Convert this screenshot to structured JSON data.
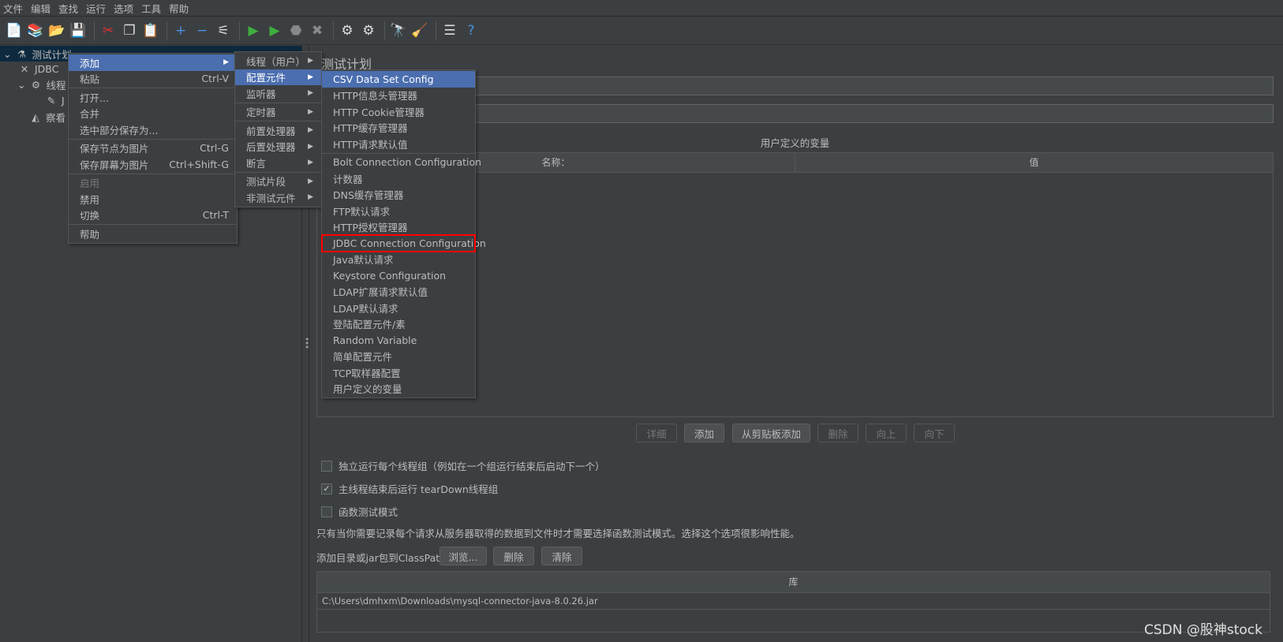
{
  "menubar": [
    "文件",
    "编辑",
    "查找",
    "运行",
    "选项",
    "工具",
    "帮助"
  ],
  "toolbar": [
    {
      "icon": "new-icon",
      "g": "📄"
    },
    {
      "icon": "templates-icon",
      "g": "📚"
    },
    {
      "icon": "open-icon",
      "g": "📂"
    },
    {
      "icon": "save-icon",
      "g": "💾"
    },
    "sep",
    {
      "icon": "cut-icon",
      "g": "✂"
    },
    {
      "icon": "copy-icon",
      "g": "❐"
    },
    {
      "icon": "paste-icon",
      "g": "📋"
    },
    "sep",
    {
      "icon": "expand-icon",
      "g": "+"
    },
    {
      "icon": "collapse-icon",
      "g": "−"
    },
    {
      "icon": "toggle-icon",
      "g": "⚟"
    },
    "sep",
    {
      "icon": "start-icon",
      "g": "▶"
    },
    {
      "icon": "start-no-pause-icon",
      "g": "▶"
    },
    {
      "icon": "stop-icon",
      "g": "⬣"
    },
    {
      "icon": "shutdown-icon",
      "g": "✖"
    },
    "sep",
    {
      "icon": "clear-icon",
      "g": "⚙"
    },
    {
      "icon": "clear-all-icon",
      "g": "⚙"
    },
    "sep",
    {
      "icon": "search-icon",
      "g": "🔭"
    },
    {
      "icon": "reset-search-icon",
      "g": "🧹"
    },
    "sep",
    {
      "icon": "function-helper-icon",
      "g": "☰"
    },
    {
      "icon": "help-icon",
      "g": "?"
    }
  ],
  "tree": [
    {
      "label": "测试计划",
      "icon": "test-plan-icon",
      "g": "⚗",
      "arrow": "⌄"
    },
    {
      "label": "JDBC",
      "icon": "jdbc-config-icon",
      "g": "✕"
    },
    {
      "label": "线程",
      "icon": "thread-group-icon",
      "g": "⚙",
      "arrow": "⌄"
    },
    {
      "label": "J",
      "icon": "sampler-icon",
      "g": "✎"
    },
    {
      "label": "察看",
      "icon": "listener-icon",
      "g": "◭"
    }
  ],
  "context_menu": [
    {
      "label": "添加",
      "sub": true,
      "hl": true
    },
    {
      "label": "粘贴",
      "sc": "Ctrl-V"
    },
    "sep",
    {
      "label": "打开..."
    },
    {
      "label": "合并"
    },
    {
      "label": "选中部分保存为..."
    },
    "sep",
    {
      "label": "保存节点为图片",
      "sc": "Ctrl-G"
    },
    {
      "label": "保存屏幕为图片",
      "sc": "Ctrl+Shift-G"
    },
    "sep",
    {
      "label": "启用",
      "dis": true
    },
    {
      "label": "禁用"
    },
    {
      "label": "切换",
      "sc": "Ctrl-T"
    },
    "sep",
    {
      "label": "帮助"
    }
  ],
  "add_menu": [
    {
      "label": "线程（用户）",
      "sub": true
    },
    {
      "label": "配置元件",
      "sub": true,
      "hl": true
    },
    {
      "label": "监听器",
      "sub": true
    },
    "sep",
    {
      "label": "定时器",
      "sub": true
    },
    "sep",
    {
      "label": "前置处理器",
      "sub": true
    },
    {
      "label": "后置处理器",
      "sub": true
    },
    {
      "label": "断言",
      "sub": true
    },
    "sep",
    {
      "label": "测试片段",
      "sub": true
    },
    {
      "label": "非测试元件",
      "sub": true
    }
  ],
  "config_menu": [
    {
      "label": "CSV Data Set Config",
      "hl": true
    },
    {
      "label": "HTTP信息头管理器"
    },
    {
      "label": "HTTP Cookie管理器"
    },
    {
      "label": "HTTP缓存管理器"
    },
    {
      "label": "HTTP请求默认值"
    },
    "sep",
    {
      "label": "Bolt Connection Configuration"
    },
    {
      "label": "计数器"
    },
    {
      "label": "DNS缓存管理器"
    },
    {
      "label": "FTP默认请求"
    },
    {
      "label": "HTTP授权管理器"
    },
    {
      "label": "JDBC Connection Configuration",
      "boxed": true
    },
    {
      "label": "Java默认请求"
    },
    {
      "label": "Keystore Configuration"
    },
    {
      "label": "LDAP扩展请求默认值"
    },
    {
      "label": "LDAP默认请求"
    },
    {
      "label": "登陆配置元件/素"
    },
    {
      "label": "Random Variable"
    },
    {
      "label": "简单配置元件"
    },
    {
      "label": "TCP取样器配置"
    },
    {
      "label": "用户定义的变量"
    }
  ],
  "panel": {
    "title": "测试计划",
    "name_value": "",
    "comment_value": "",
    "vars_title": "用户定义的变量",
    "vars_cols": [
      "名称：",
      "值"
    ],
    "buttons": [
      {
        "label": "详细",
        "dis": true
      },
      {
        "label": "添加"
      },
      {
        "label": "从剪贴板添加"
      },
      {
        "label": "删除",
        "dis": true
      },
      {
        "label": "向上",
        "dis": true
      },
      {
        "label": "向下",
        "dis": true
      }
    ],
    "checks": [
      {
        "label": "独立运行每个线程组（例如在一个组运行结束后启动下一个）",
        "checked": false
      },
      {
        "label": "主线程结束后运行 tearDown线程组",
        "checked": true
      },
      {
        "label": "函数测试模式",
        "checked": false
      }
    ],
    "note": "只有当你需要记录每个请求从服务器取得的数据到文件时才需要选择函数测试模式。选择这个选项很影响性能。",
    "classpath_label": "添加目录或jar包到ClassPath",
    "classpath_buttons": [
      "浏览...",
      "删除",
      "清除"
    ],
    "lib_header": "库",
    "lib_rows": [
      "C:\\Users\\dmhxm\\Downloads\\mysql-connector-java-8.0.26.jar"
    ]
  },
  "watermark": "CSDN @股神stock",
  "colors": {
    "highlight": "#4b6eaf",
    "box": "#ff0000",
    "bg": "#3c3f41",
    "tree_selected": "#0d293e"
  }
}
